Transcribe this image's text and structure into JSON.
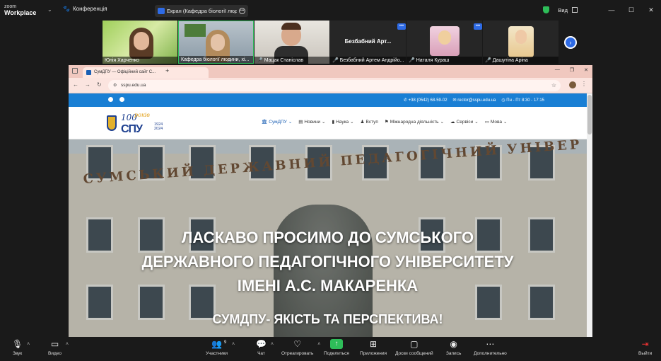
{
  "app": {
    "logo_line1": "zoom",
    "logo_line2": "Workplace"
  },
  "topbar": {
    "conference_label": "Конференція",
    "share_label": "Екран (Кафедра біології людини",
    "view_label": "Вид"
  },
  "participants": [
    {
      "name": "Юлія Харченко",
      "muted": false
    },
    {
      "name": "Кафедра біології людини, хі...",
      "muted": false
    },
    {
      "name": "Мацак Станіслав",
      "muted": true
    },
    {
      "name": "Безбабний Артем Андрійо...",
      "display_name": "Безбабний Арт...",
      "muted": true
    },
    {
      "name": "Наталя Кураш",
      "muted": true
    },
    {
      "name": "Дашутіна Аріна",
      "muted": true
    }
  ],
  "browser": {
    "tab_title": "СумДПУ — Офіційний сайт С...",
    "url": "sspu.edu.ua"
  },
  "site": {
    "phone": "+38 (0542) 68-59-02",
    "email": "rector@sspu.edu.ua",
    "hours": "Пн - Пт 8:30 - 17:15",
    "logo_number": "100",
    "logo_word": "років",
    "logo_abbr": "СПУ",
    "logo_years": "1924\n2024",
    "menu": [
      "СумДПУ",
      "Новини",
      "Наука",
      "Вступ",
      "Міжнародна діяльність",
      "Сервіси",
      "Мова"
    ],
    "building_sign": "СУМСЬКИЙ ДЕРЖАВНИЙ ПЕДАГОГІЧНИЙ УНІВЕР",
    "hero_line1": "ЛАСКАВО ПРОСИМО ДО СУМСЬКОГО",
    "hero_line2": "ДЕРЖАВНОГО ПЕДАГОГІЧНОГО УНІВЕРСИТЕТУ",
    "hero_line3": "ІМЕНІ А.С. МАКАРЕНКА",
    "hero_slogan": "СУМДПУ- ЯКІСТЬ ТА ПЕРСПЕКТИВА!"
  },
  "toolbar": {
    "audio": "Звук",
    "video": "Видео",
    "participants": "Участники",
    "participants_count": "9",
    "chat": "Чат",
    "react": "Отреагировать",
    "share": "Поделиться",
    "apps": "Приложения",
    "whiteboard": "Доски сообщений",
    "record": "Запись",
    "more": "Дополнительно",
    "leave": "Выйти"
  },
  "colors": {
    "zoom_blue": "#2e6be6",
    "share_green": "#2ebd59",
    "site_blue": "#1a7fd4",
    "leave_red": "#e33333"
  }
}
